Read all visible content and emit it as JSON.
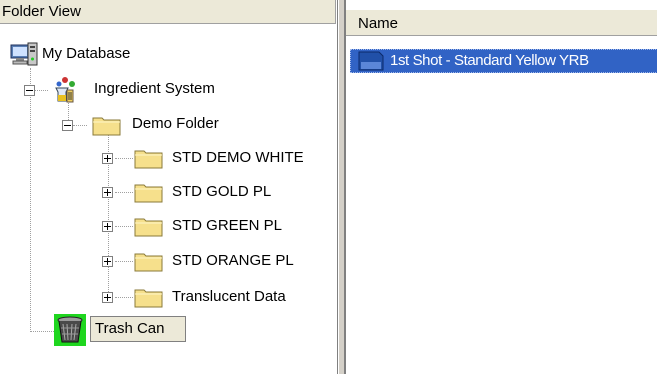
{
  "folder_view": {
    "title": "Folder View",
    "tree": {
      "database": "My Database",
      "system": "Ingredient System",
      "folder": "Demo Folder",
      "children": [
        "STD DEMO WHITE",
        "STD GOLD PL",
        "STD GREEN PL",
        "STD ORANGE PL",
        "Translucent Data"
      ],
      "trash": "Trash Can"
    }
  },
  "list_view": {
    "column_name": "Name",
    "items": [
      "1st Shot - Standard Yellow YRB"
    ]
  },
  "colors": {
    "selection": "#3163c5",
    "folder": "#f6e08c",
    "header": "#ece9d8"
  }
}
